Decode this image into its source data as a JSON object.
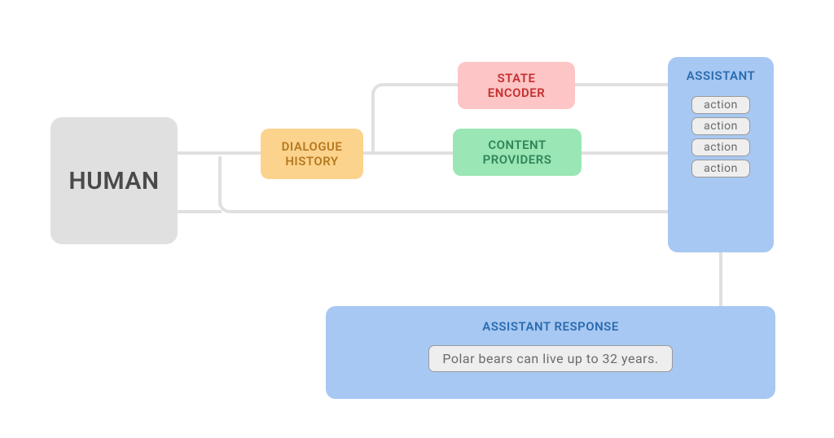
{
  "nodes": {
    "human": "HUMAN",
    "dialogue_line1": "DIALOGUE",
    "dialogue_line2": "HISTORY",
    "state_line1": "STATE",
    "state_line2": "ENCODER",
    "content_line1": "CONTENT",
    "content_line2": "PROVIDERS",
    "assistant": "ASSISTANT",
    "assistant_response_title": "ASSISTANT RESPONSE"
  },
  "actions": [
    "action",
    "action",
    "action",
    "action"
  ],
  "response_text": "Polar bears can live up to 32 years.",
  "colors": {
    "human_bg": "#e0e0e0",
    "dialogue_bg": "#fbd38d",
    "state_bg": "#fdc5c5",
    "content_bg": "#9ae6b4",
    "assistant_bg": "#a7c8f2",
    "connector": "#e0e0e0"
  }
}
